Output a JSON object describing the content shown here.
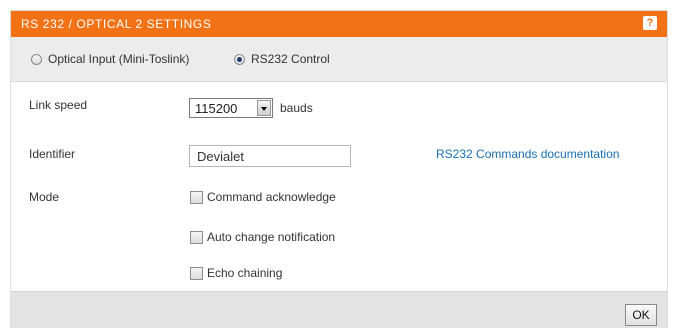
{
  "dialog": {
    "title": "RS 232 / OPTICAL 2 SETTINGS",
    "help_icon": "question-mark-icon",
    "help_label": "?",
    "accent_color": "#f47216"
  },
  "mode_selector": {
    "options": [
      {
        "label": "Optical Input (Mini-Toslink)",
        "selected": false
      },
      {
        "label": "RS232 Control",
        "selected": true
      }
    ]
  },
  "link_speed": {
    "label": "Link speed",
    "value": "115200",
    "unit": "bauds"
  },
  "identifier": {
    "label": "Identifier",
    "value": "Devialet"
  },
  "docs_link": {
    "label": "RS232 Commands documentation",
    "color": "#1a6fb4"
  },
  "mode": {
    "label": "Mode",
    "options": [
      {
        "label": "Command acknowledge",
        "checked": false
      },
      {
        "label": "Auto change notification",
        "checked": false
      },
      {
        "label": "Echo chaining",
        "checked": false
      }
    ]
  },
  "footer": {
    "ok_label": "OK"
  }
}
